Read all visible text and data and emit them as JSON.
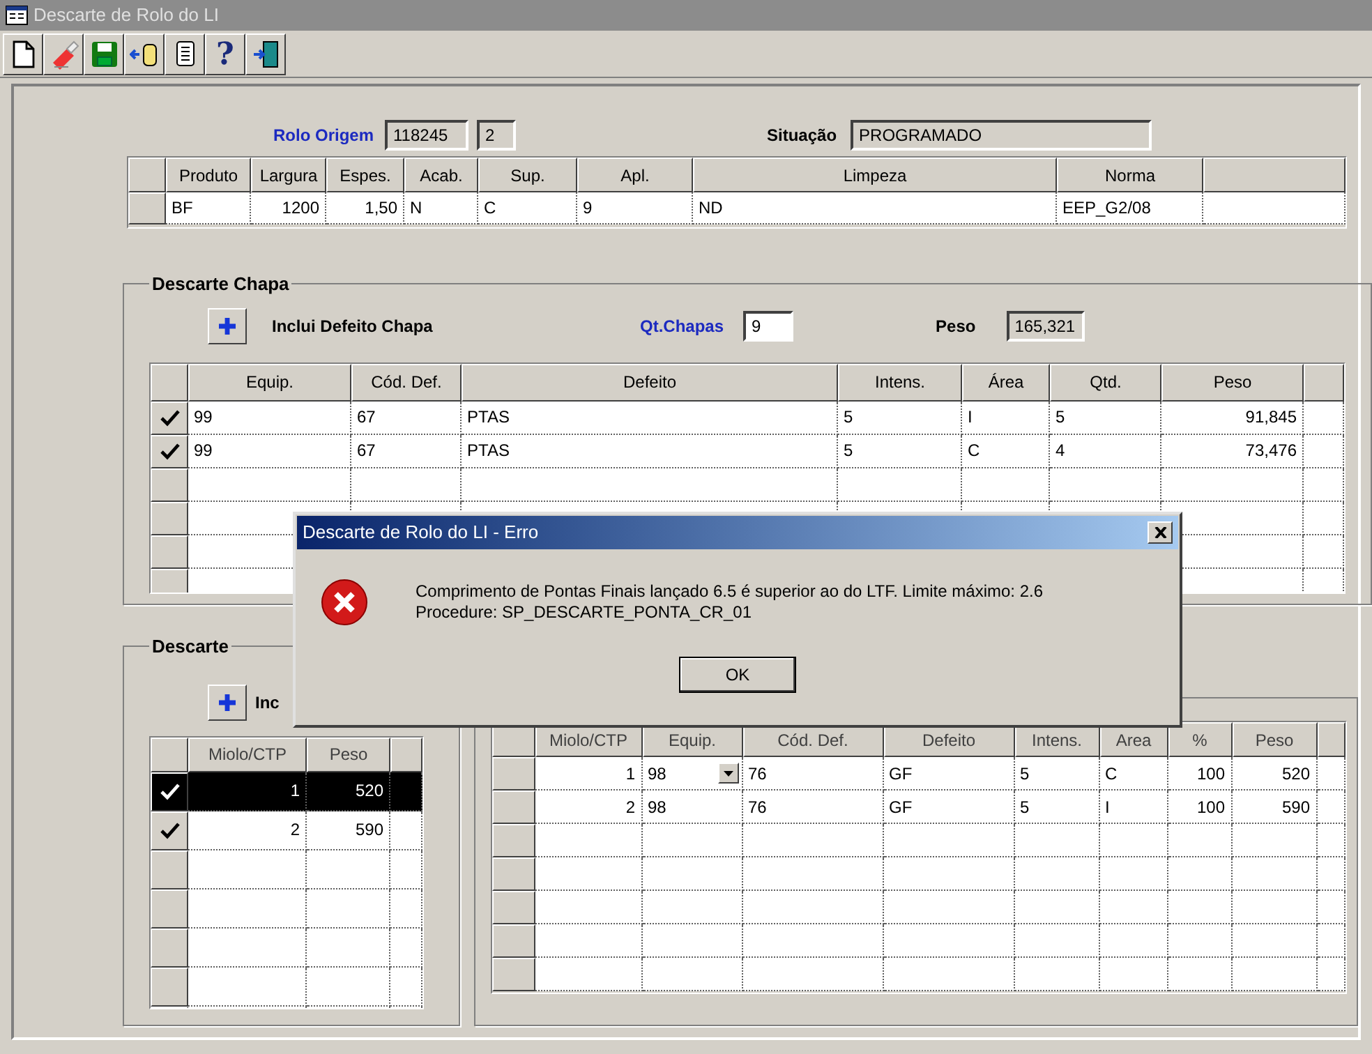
{
  "window": {
    "title": "Descarte de Rolo do LI"
  },
  "toolbar": [
    {
      "kind": "new"
    },
    {
      "kind": "eraser"
    },
    {
      "kind": "save"
    },
    {
      "kind": "import"
    },
    {
      "kind": "copy"
    },
    {
      "kind": "help",
      "label": "?"
    },
    {
      "kind": "exit"
    }
  ],
  "header": {
    "rolo_label": "Rolo Origem",
    "rolo_value": "118245",
    "rolo_seq": "2",
    "situacao_label": "Situação",
    "situacao_value": "PROGRAMADO"
  },
  "product_table": {
    "columns": [
      "Produto",
      "Largura",
      "Espes.",
      "Acab.",
      "Sup.",
      "Apl.",
      "Limpeza",
      "Norma"
    ],
    "rows": [
      {
        "cells": [
          "BF",
          "1200",
          "1,50",
          "N",
          "C",
          "9",
          "ND",
          "EEP_G2/08"
        ]
      }
    ]
  },
  "descarte_chapa": {
    "title": "Descarte Chapa",
    "add_label": "Inclui Defeito Chapa",
    "qt_label": "Qt.Chapas",
    "qt_value": "9",
    "peso_label": "Peso",
    "peso_value": "165,321",
    "table": {
      "columns": [
        "Equip.",
        "Cód. Def.",
        "Defeito",
        "Intens.",
        "Área",
        "Qtd.",
        "Peso"
      ],
      "rows": [
        {
          "checked": true,
          "cells": [
            "99",
            "67",
            "PTAS",
            "5",
            "I",
            "5",
            "91,845"
          ]
        },
        {
          "checked": true,
          "cells": [
            "99",
            "67",
            "PTAS",
            "5",
            "C",
            "4",
            "73,476"
          ]
        }
      ]
    }
  },
  "descarte": {
    "title": "Descarte",
    "add_label": "Inc",
    "left_table": {
      "columns": [
        "Miolo/CTP",
        "Peso"
      ],
      "rows": [
        {
          "checked": true,
          "selected": true,
          "cells": [
            "1",
            "520"
          ]
        },
        {
          "checked": true,
          "selected": false,
          "cells": [
            "2",
            "590"
          ]
        }
      ]
    },
    "right_table": {
      "columns": [
        "Miolo/CTP",
        "Equip.",
        "Cód. Def.",
        "Defeito",
        "Intens.",
        "Area",
        "%",
        "Peso"
      ],
      "rows": [
        {
          "dropdown": true,
          "cells": [
            "1",
            "98",
            "76",
            "GF",
            "5",
            "C",
            "100",
            "520"
          ]
        },
        {
          "dropdown": false,
          "cells": [
            "2",
            "98",
            "76",
            "GF",
            "5",
            "I",
            "100",
            "590"
          ]
        }
      ]
    }
  },
  "dialog": {
    "title": "Descarte de Rolo do LI - Erro",
    "kind": "error",
    "lines": [
      "Comprimento de Pontas Finais lançado 6.5 é superior ao do LTF. Limite máximo: 2.6",
      "Procedure: SP_DESCARTE_PONTA_CR_01"
    ],
    "ok": "OK"
  }
}
